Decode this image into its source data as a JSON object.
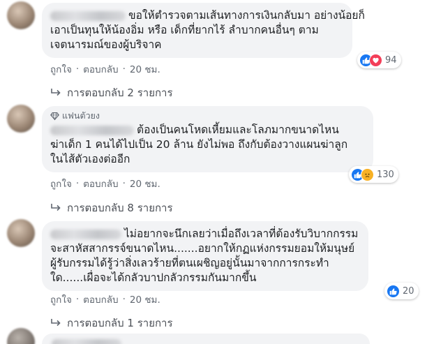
{
  "comments": [
    {
      "lines": [
        "ขอให้ตำรวจตามเส้นทางการเงินกลับมา อย่างน้อยก็",
        "เอาเป็นทุนให้น้องอิ่ม หรือ เด็กที่ยากไร้ ลำบากคนอื่นๆ ตาม",
        "เจตนารมณ์ของผู้บริจาค"
      ],
      "reactions": [
        "like",
        "love"
      ],
      "reaction_count": "94",
      "like_label": "ถูกใจ",
      "reply_label": "ตอบกลับ",
      "time": "20 ชม.",
      "replies_label": "การตอบกลับ 2 รายการ"
    },
    {
      "badge": "แฟนตัวยง",
      "lines": [
        "ต้องเป็นคนโหดเหี้ยมและโลภมากขนาดไหน",
        "ฆ่าเด็ก 1 คนได้ไปเป็น 20 ล้าน ยังไม่พอ ถึงกับต้องวางแผนฆ่าลูก",
        "ในไส้ตัวเองต่ออีก"
      ],
      "reactions": [
        "like",
        "sad"
      ],
      "reaction_count": "130",
      "like_label": "ถูกใจ",
      "reply_label": "ตอบกลับ",
      "time": "20 ชม.",
      "replies_label": "การตอบกลับ 8 รายการ"
    },
    {
      "lines": [
        "ไม่อยากจะนึกเลยว่าเมื่อถึงเวลาที่ต้องรับวิบากกรรม",
        "จะสาหัสสากรรจ์ขนาดไหน.......อยากให้กฏแห่งกรรมยอมให้มนุษย์",
        "ผู้รับกรรมได้รู้ว่าสิ่งเลวร้ายที่ตนเผชิญอยู่นั้นมาจากการกระทำ",
        "ใด......เผื่อจะได้กลัวบาปกลัวกรรมกันมากขึ้น"
      ],
      "reactions": [
        "like"
      ],
      "reaction_count": "20",
      "like_label": "ถูกใจ",
      "reply_label": "ตอบกลับ",
      "time": "20 ชม.",
      "replies_label": "การตอบกลับ 1 รายการ"
    }
  ],
  "colors": {
    "bubble": "#f2f3f5",
    "meta_text": "#606770",
    "like": "#1877f2",
    "love": "#f33e58",
    "sad": "#f7b125"
  }
}
